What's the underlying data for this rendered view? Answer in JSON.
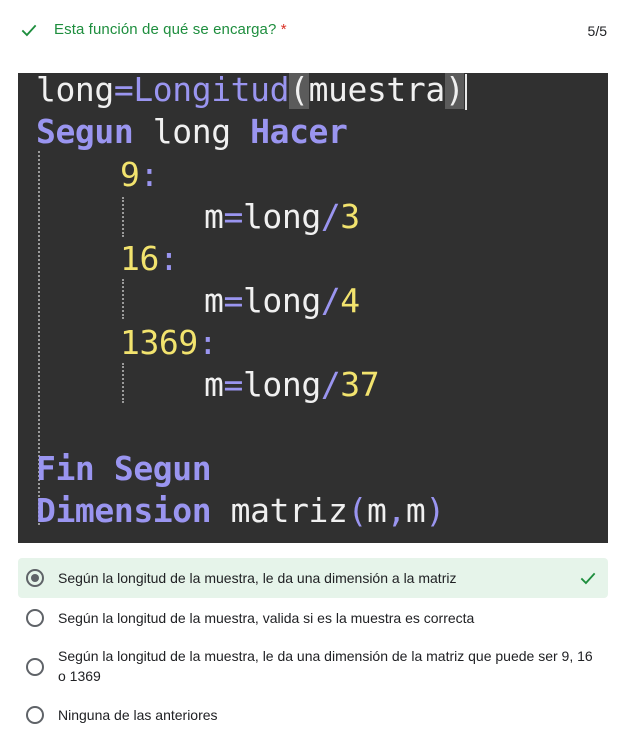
{
  "question": {
    "title": "Esta función de qué se encarga?",
    "required_mark": "*",
    "score": "5/5",
    "status_icon": "check-icon",
    "accent_color": "#1e8e3e"
  },
  "code": {
    "line1": {
      "a": "long",
      "eq": "=",
      "fn": "Longitud",
      "po": "(",
      "arg": "muestra",
      "pc": ")"
    },
    "line2": {
      "kw1": "Segun",
      "var": " long ",
      "kw2": "Hacer"
    },
    "case1": {
      "val": "9",
      "colon": ":"
    },
    "stmt1": {
      "lhs": "m",
      "eq": "=",
      "var": "long",
      "op": "/",
      "num": "3"
    },
    "case2": {
      "val": "16",
      "colon": ":"
    },
    "stmt2": {
      "lhs": "m",
      "eq": "=",
      "var": "long",
      "op": "/",
      "num": "4"
    },
    "case3": {
      "val": "1369",
      "colon": ":"
    },
    "stmt3": {
      "lhs": "m",
      "eq": "=",
      "var": "long",
      "op": "/",
      "num": "37"
    },
    "line_end": {
      "kw1": "Fin",
      "kw2": "Segun"
    },
    "line_dim": {
      "kw": "Dimension",
      "name": " matriz",
      "po": "(",
      "a": "m",
      "comma": ",",
      "b": "m",
      "pc": ")"
    }
  },
  "options": [
    {
      "label": "Según la longitud de la muestra, le da una dimensión a la matriz",
      "selected": true,
      "correct": true
    },
    {
      "label": "Según la longitud de la muestra, valida si es la muestra es correcta",
      "selected": false,
      "correct": false
    },
    {
      "label": "Según la longitud de la muestra, le da una dimensión de la matriz que puede ser 9, 16 o 1369",
      "selected": false,
      "correct": false
    },
    {
      "label": "Ninguna de las anteriores",
      "selected": false,
      "correct": false
    }
  ]
}
